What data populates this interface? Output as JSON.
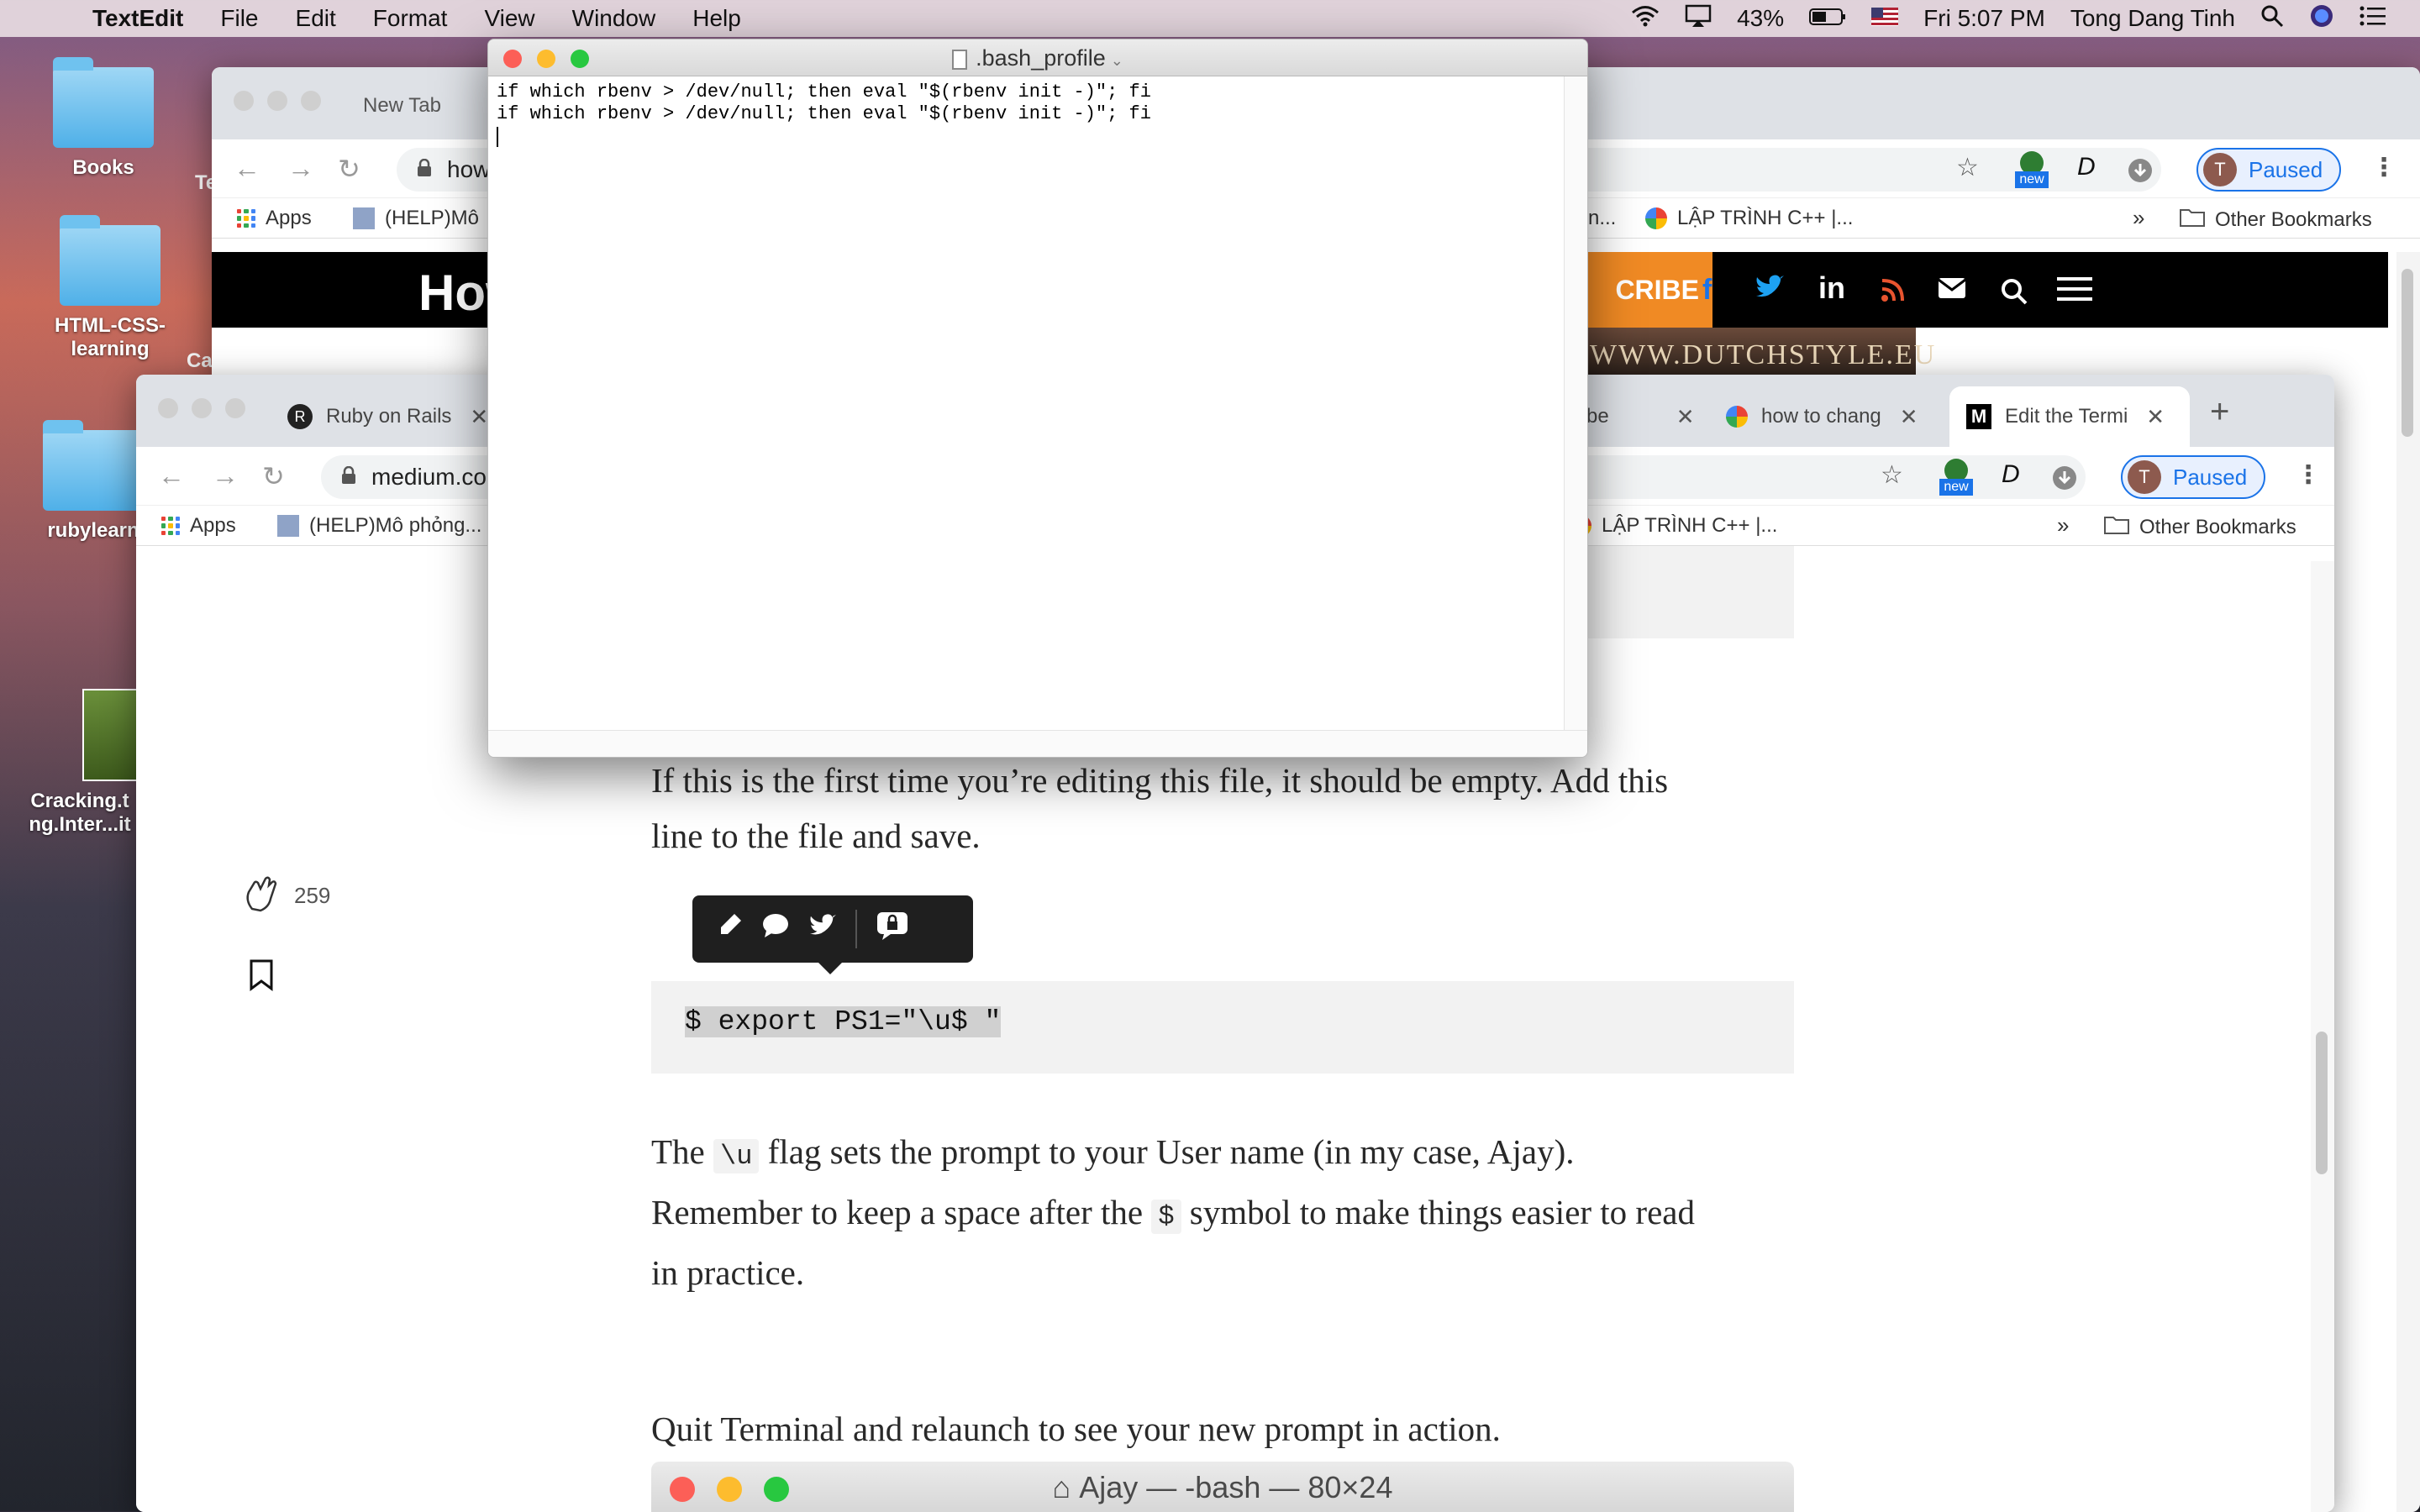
{
  "menubar": {
    "app_name": "TextEdit",
    "items": [
      "File",
      "Edit",
      "Format",
      "View",
      "Window",
      "Help"
    ],
    "battery": "43%",
    "clock": "Fri 5:07 PM",
    "user": "Tong Dang Tinh"
  },
  "desktop": {
    "icons": [
      "Books",
      "HTML-CSS-learning",
      "rubylearn",
      "Cracking.t ng.Inter...it"
    ],
    "partial_labels": [
      "Te",
      "Ca"
    ]
  },
  "back_browser": {
    "tab_title": "New Tab",
    "url": "how",
    "bookmark_apps": "Apps",
    "bookmark_1": "(HELP)Mô",
    "bookmark_right_partial": "n...",
    "bookmark_cpp": "LẬP TRÌNH C++ |...",
    "more_bookmarks": "»",
    "other_bookmarks": "Other Bookmarks",
    "paused_label": "Paused",
    "avatar_initial": "T",
    "new_badge": "new",
    "site_logo_partial": "How",
    "subscribe_partial": "CRIBE",
    "banner_partial": "WWW.DUTCHSTYLE.EU"
  },
  "front_browser": {
    "tabs": [
      {
        "title": "Ruby on Rails",
        "close": "✕"
      },
      {
        "title": "be",
        "close": "✕"
      },
      {
        "title": "how to chang",
        "close": "✕"
      },
      {
        "title": "Edit the Termi",
        "close": "✕"
      }
    ],
    "new_tab": "+",
    "url": "medium.co",
    "bookmark_apps": "Apps",
    "bookmark_1": "(HELP)Mô phỏng...",
    "bookmark_cpp": "LẬP TRÌNH C++ |...",
    "more_bookmarks": "»",
    "other_bookmarks": "Other Bookmarks",
    "paused_label": "Paused",
    "avatar_initial": "T",
    "new_badge": "new"
  },
  "article": {
    "para1_line1": "If this is the first time you’re editing this file, it should be empty. Add this",
    "para1_line2": "line to the file and save.",
    "clap_count": "259",
    "code": "$ export PS1=\"\\u$ \"",
    "para2_a": "The ",
    "para2_code1": "\\u",
    "para2_b": " flag sets the prompt to your User name (in my case, Ajay).",
    "para2_line2_a": "Remember to keep a space after the ",
    "para2_code2": "$",
    "para2_line2_b": " symbol to make things easier to read",
    "para2_line3": "in practice.",
    "para3": "Quit Terminal and relaunch to see your new prompt in action.",
    "terminal_title": "Ajay — -bash — 80×24"
  },
  "textedit": {
    "title": ".bash_profile",
    "lines": [
      "if which rbenv > /dev/null; then eval \"$(rbenv init -)\"; fi",
      "if which rbenv > /dev/null; then eval \"$(rbenv init -)\"; fi"
    ]
  },
  "colors": {
    "close": "#fc5f57",
    "minimize": "#fdbc2e",
    "zoom": "#28c840",
    "accent_blue": "#1a73e8",
    "orange": "#f39c12"
  }
}
